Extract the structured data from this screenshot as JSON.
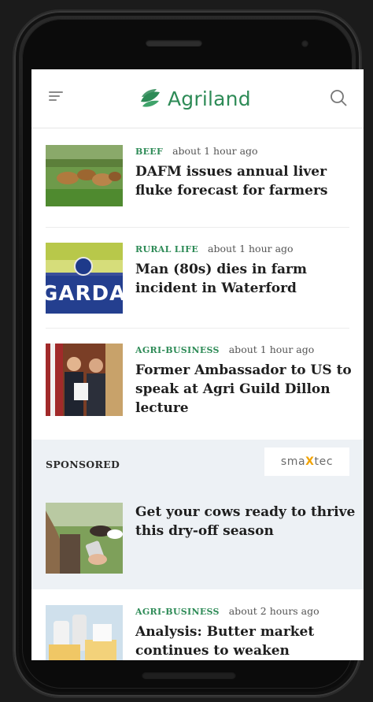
{
  "header": {
    "logo_text": "Agriland",
    "brand_color": "#2e8b57",
    "menu_icon": "menu-icon",
    "search_icon": "search-icon"
  },
  "articles": [
    {
      "category": "BEEF",
      "time": "about 1 hour ago",
      "title": "DAFM issues annual liver fluke forecast for farmers",
      "thumb": "cattle-in-field"
    },
    {
      "category": "RURAL LIFE",
      "time": "about 1 hour ago",
      "title": "Man (80s) dies in farm incident in Waterford",
      "thumb": "garda-sign",
      "thumb_text": "GARDA"
    },
    {
      "category": "AGRI-BUSINESS",
      "time": "about 1 hour ago",
      "title": "Former Ambassador to US to speak at Agri Guild Dillon lecture",
      "thumb": "people-with-flags"
    }
  ],
  "sponsored": {
    "label": "SPONSORED",
    "sponsor_logo_a": "sma",
    "sponsor_logo_x": "X",
    "sponsor_logo_b": "tec",
    "title": "Get your cows ready to thrive this dry-off season",
    "thumb": "farmer-with-phone-and-cows"
  },
  "more_articles": [
    {
      "category": "AGRI-BUSINESS",
      "time": "about 2 hours ago",
      "title": "Analysis: Butter market continues to weaken",
      "thumb": "dairy-products"
    }
  ]
}
